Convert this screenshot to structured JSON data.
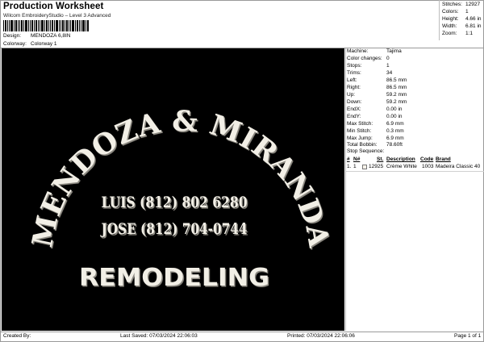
{
  "header": {
    "title": "Production Worksheet",
    "subtitle": "Wilcom EmbroideryStudio – Level 3 Advanced",
    "design_label": "Design:",
    "design_value": "MENDOZA 6,8IN",
    "colorway_label": "Colorway:",
    "colorway_value": "Colorway 1"
  },
  "summary": [
    {
      "label": "Stitches:",
      "value": "12927"
    },
    {
      "label": "Colors:",
      "value": "1"
    },
    {
      "label": "Height:",
      "value": "4.66 in"
    },
    {
      "label": "Width:",
      "value": "6.81 in"
    },
    {
      "label": "Zoom:",
      "value": "1:1"
    }
  ],
  "design_text": {
    "arc": "MENDOZA & MIRANDA",
    "line1": "LUIS (812) 802 6280",
    "line2": "JOSE (812) 704-0744",
    "line3": "REMODELING"
  },
  "details": [
    {
      "label": "Machine:",
      "value": "Tajima"
    },
    {
      "label": "Color changes:",
      "value": "0"
    },
    {
      "label": "Stops:",
      "value": "1"
    },
    {
      "label": "Trims:",
      "value": "34"
    },
    {
      "label": "Left:",
      "value": "86.5 mm"
    },
    {
      "label": "Right:",
      "value": "86.5 mm"
    },
    {
      "label": "Up:",
      "value": "59.2 mm"
    },
    {
      "label": "Down:",
      "value": "59.2 mm"
    },
    {
      "label": "EndX:",
      "value": "0.00 in"
    },
    {
      "label": "EndY:",
      "value": "0.00 in"
    },
    {
      "label": "Max Stitch:",
      "value": "6.9 mm"
    },
    {
      "label": "Min Stitch:",
      "value": "0.3 mm"
    },
    {
      "label": "Max Jump:",
      "value": "6.9 mm"
    },
    {
      "label": "Total Bobbin:",
      "value": "78.60ft"
    }
  ],
  "stop_sequence": {
    "title": "Stop Sequence:",
    "headers": {
      "hash": "#",
      "n": "N#",
      "st": "St.",
      "description": "Description",
      "code": "Code",
      "brand": "Brand"
    },
    "rows": [
      {
        "hash": "1.",
        "n": "1",
        "st": "12925",
        "description": "Crème White",
        "code": "1003",
        "brand": "Madeira Classic 40",
        "color": "#f7f3ea"
      }
    ]
  },
  "footer": {
    "created_by": "Created By:",
    "last_saved": "Last Saved: 07/03/2024 22:06:03",
    "printed": "Printed: 07/03/2024 22:06:06",
    "page": "Page 1 of 1"
  },
  "colors": {
    "canvas": "#000000",
    "thread": "#f2efe6"
  }
}
